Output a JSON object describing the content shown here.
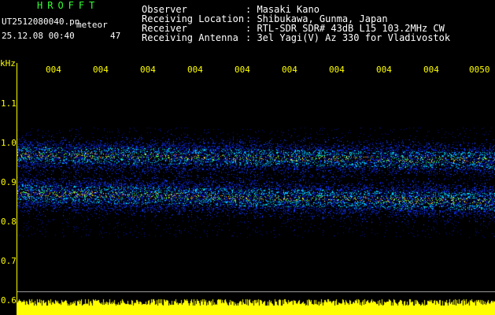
{
  "header": {
    "brand": "HROFFT",
    "filename": "UT2512080040.pn",
    "tag": "meteor",
    "datetime": "25.12.08 00:40",
    "count": "47"
  },
  "info": [
    {
      "label": "Observer",
      "value": ": Masaki Kano"
    },
    {
      "label": "Receiving Location",
      "value": ": Shibukawa, Gunma, Japan"
    },
    {
      "label": "Receiver",
      "value": ": RTL-SDR SDR# 43dB L15 103.2MHz CW"
    },
    {
      "label": "Receiving Antenna",
      "value": ": 3el Yagi(V) Az 330 for Vladivostok"
    }
  ],
  "axis": {
    "unit": "kHz",
    "time_ticks": [
      "004",
      "004",
      "004",
      "004",
      "004",
      "004",
      "004",
      "004",
      "004",
      "0050"
    ],
    "freq_ticks": [
      "1.1",
      "1.0",
      "0.9",
      "0.8",
      "0.7",
      "0.6"
    ]
  },
  "colors": {
    "text_green": "#33ff33",
    "text_white": "#ffffff",
    "axis_yellow": "#ffff00",
    "background": "#000000"
  }
}
